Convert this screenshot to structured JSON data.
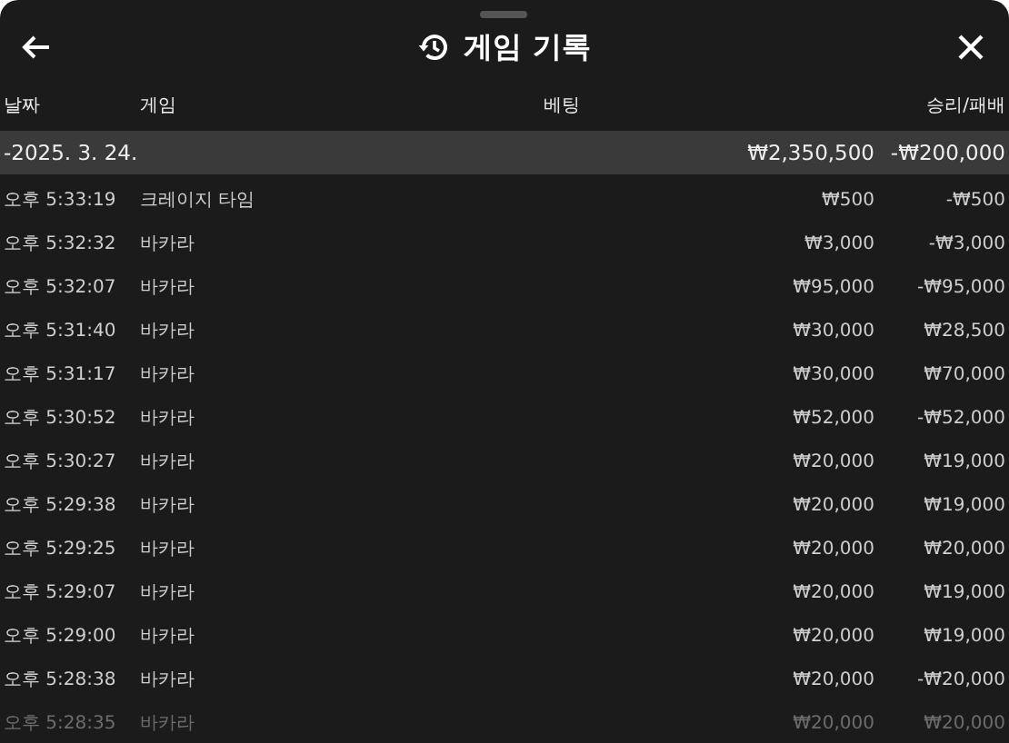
{
  "header": {
    "title": "게임 기록"
  },
  "columns": [
    "날짜",
    "게임",
    "베팅",
    "승리/패배"
  ],
  "group": {
    "date": "-2025. 3. 24.",
    "bet": "₩2,350,500",
    "result": "-₩200,000"
  },
  "rows": [
    {
      "time": "오후 5:33:19",
      "game": "크레이지 타임",
      "bet": "₩500",
      "result": "-₩500"
    },
    {
      "time": "오후 5:32:32",
      "game": "바카라",
      "bet": "₩3,000",
      "result": "-₩3,000"
    },
    {
      "time": "오후 5:32:07",
      "game": "바카라",
      "bet": "₩95,000",
      "result": "-₩95,000"
    },
    {
      "time": "오후 5:31:40",
      "game": "바카라",
      "bet": "₩30,000",
      "result": "₩28,500"
    },
    {
      "time": "오후 5:31:17",
      "game": "바카라",
      "bet": "₩30,000",
      "result": "₩70,000"
    },
    {
      "time": "오후 5:30:52",
      "game": "바카라",
      "bet": "₩52,000",
      "result": "-₩52,000"
    },
    {
      "time": "오후 5:30:27",
      "game": "바카라",
      "bet": "₩20,000",
      "result": "₩19,000"
    },
    {
      "time": "오후 5:29:38",
      "game": "바카라",
      "bet": "₩20,000",
      "result": "₩19,000"
    },
    {
      "time": "오후 5:29:25",
      "game": "바카라",
      "bet": "₩20,000",
      "result": "₩20,000"
    },
    {
      "time": "오후 5:29:07",
      "game": "바카라",
      "bet": "₩20,000",
      "result": "₩19,000"
    },
    {
      "time": "오후 5:29:00",
      "game": "바카라",
      "bet": "₩20,000",
      "result": "₩19,000"
    },
    {
      "time": "오후 5:28:38",
      "game": "바카라",
      "bet": "₩20,000",
      "result": "-₩20,000"
    },
    {
      "time": "오후 5:28:35",
      "game": "바카라",
      "bet": "₩20,000",
      "result": "₩20,000"
    }
  ]
}
